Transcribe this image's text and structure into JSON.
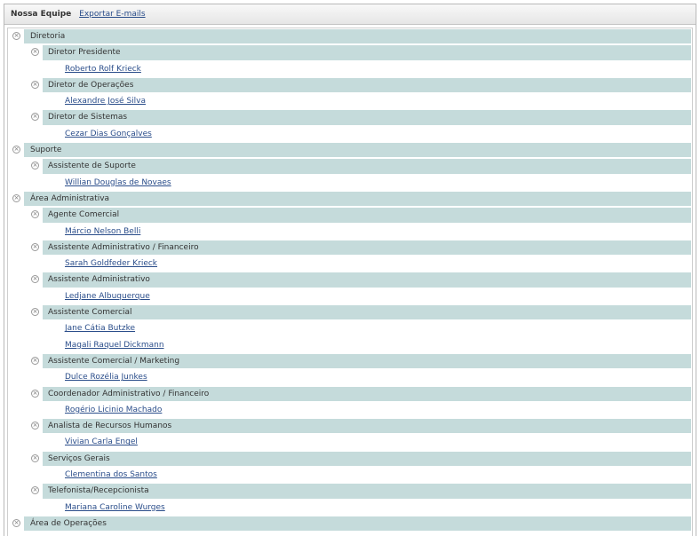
{
  "header": {
    "title": "Nossa Equipe",
    "export_label": "Exportar E-mails"
  },
  "toggle_icon": "collapse-icon",
  "band_color": "#c5dbdb",
  "link_color": "#2a4d8a",
  "tree": [
    {
      "label": "Diretoria",
      "children": [
        {
          "label": "Diretor Presidente",
          "children": [
            "Roberto Rolf Krieck"
          ]
        },
        {
          "label": "Diretor de Operações",
          "children": [
            "Alexandre José Silva"
          ]
        },
        {
          "label": "Diretor de Sistemas",
          "children": [
            "Cezar Dias Gonçalves"
          ]
        }
      ]
    },
    {
      "label": "Suporte",
      "children": [
        {
          "label": "Assistente de Suporte",
          "children": [
            "Willian Douglas de Novaes"
          ]
        }
      ]
    },
    {
      "label": "Área Administrativa",
      "children": [
        {
          "label": "Agente Comercial",
          "children": [
            "Márcio Nelson Belli"
          ]
        },
        {
          "label": "Assistente Administrativo / Financeiro",
          "children": [
            "Sarah Goldfeder Krieck"
          ]
        },
        {
          "label": "Assistente Administrativo",
          "children": [
            "Ledjane Albuquerque"
          ]
        },
        {
          "label": "Assistente Comercial",
          "children": [
            "Jane Cátia Butzke",
            "Magali Raquel Dickmann"
          ]
        },
        {
          "label": "Assistente Comercial / Marketing",
          "children": [
            "Dulce Rozélia Junkes"
          ]
        },
        {
          "label": "Coordenador Administrativo / Financeiro",
          "children": [
            "Rogério Licinio Machado"
          ]
        },
        {
          "label": "Analista de Recursos Humanos",
          "children": [
            "Vivian Carla Engel"
          ]
        },
        {
          "label": "Serviços Gerais",
          "children": [
            "Clementina dos Santos"
          ]
        },
        {
          "label": "Telefonista/Recepcionista",
          "children": [
            "Mariana Caroline Wurges"
          ]
        }
      ]
    },
    {
      "label": "Área de Operações",
      "children": []
    }
  ]
}
